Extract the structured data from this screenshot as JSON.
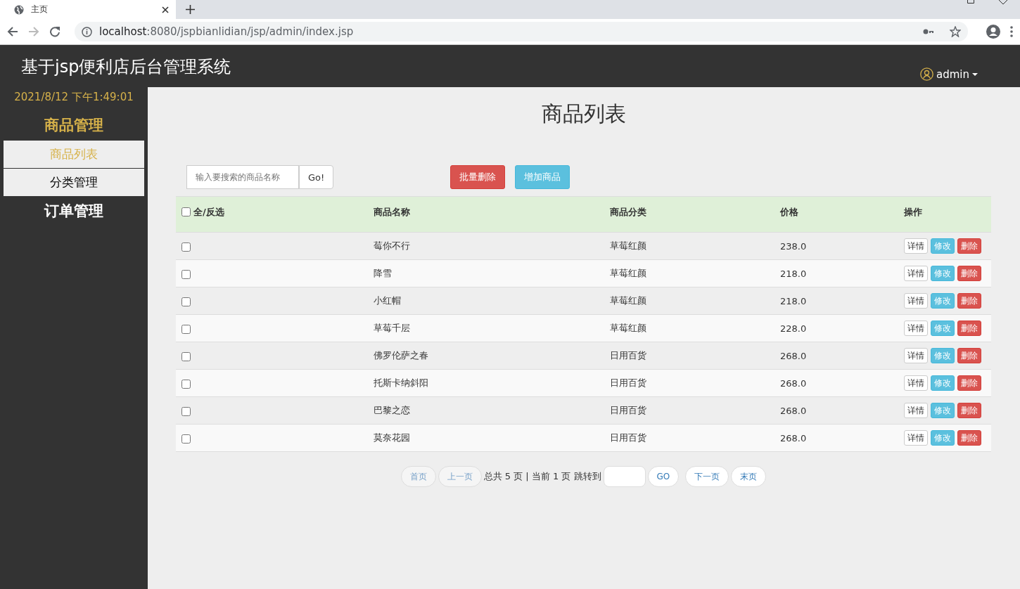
{
  "browser": {
    "tab_title": "主页",
    "url_host": "localhost",
    "url_path": ":8080/jspbianlidian/jsp/admin/index.jsp"
  },
  "header": {
    "title": "基于jsp便利店后台管理系统",
    "user": "admin"
  },
  "sidebar": {
    "datetime": "2021/8/12 下午1:49:01",
    "groups": [
      {
        "label": "商品管理",
        "selected": true,
        "items": [
          {
            "label": "商品列表",
            "selected": true
          },
          {
            "label": "分类管理",
            "selected": false
          }
        ]
      },
      {
        "label": "订单管理",
        "selected": false
      }
    ]
  },
  "page_title": "商品列表",
  "search": {
    "placeholder": "输入要搜索的商品名称",
    "button": "Go!"
  },
  "toolbar_buttons": [
    {
      "label": "批量删除",
      "kind": "danger"
    },
    {
      "label": "增加商品",
      "kind": "info"
    }
  ],
  "table": {
    "select_all": {
      "label": "全/反选",
      "checked": false
    },
    "columns": [
      "商品名称",
      "商品分类",
      "价格",
      "操作"
    ],
    "rows": [
      {
        "checked": false,
        "name": "莓你不行",
        "category": "草莓红颜",
        "price": "238.0",
        "actions": [
          {
            "label": "详情",
            "kind": "default"
          },
          {
            "label": "修改",
            "kind": "info"
          },
          {
            "label": "删除",
            "kind": "danger"
          }
        ]
      },
      {
        "checked": false,
        "name": "降雪",
        "category": "草莓红颜",
        "price": "218.0",
        "actions": [
          {
            "label": "详情",
            "kind": "default"
          },
          {
            "label": "修改",
            "kind": "info"
          },
          {
            "label": "删除",
            "kind": "danger"
          }
        ]
      },
      {
        "checked": false,
        "name": "小红帽",
        "category": "草莓红颜",
        "price": "218.0",
        "actions": [
          {
            "label": "详情",
            "kind": "default"
          },
          {
            "label": "修改",
            "kind": "info"
          },
          {
            "label": "删除",
            "kind": "danger"
          }
        ]
      },
      {
        "checked": false,
        "name": "草莓千层",
        "category": "草莓红颜",
        "price": "228.0",
        "actions": [
          {
            "label": "详情",
            "kind": "default"
          },
          {
            "label": "修改",
            "kind": "info"
          },
          {
            "label": "删除",
            "kind": "danger"
          }
        ]
      },
      {
        "checked": false,
        "name": "佛罗伦萨之春",
        "category": "日用百货",
        "price": "268.0",
        "actions": [
          {
            "label": "详情",
            "kind": "default"
          },
          {
            "label": "修改",
            "kind": "info"
          },
          {
            "label": "删除",
            "kind": "danger"
          }
        ]
      },
      {
        "checked": false,
        "name": "托斯卡纳斜阳",
        "category": "日用百货",
        "price": "268.0",
        "actions": [
          {
            "label": "详情",
            "kind": "default"
          },
          {
            "label": "修改",
            "kind": "info"
          },
          {
            "label": "删除",
            "kind": "danger"
          }
        ]
      },
      {
        "checked": false,
        "name": "巴黎之恋",
        "category": "日用百货",
        "price": "268.0",
        "actions": [
          {
            "label": "详情",
            "kind": "default"
          },
          {
            "label": "修改",
            "kind": "info"
          },
          {
            "label": "删除",
            "kind": "danger"
          }
        ]
      },
      {
        "checked": false,
        "name": "莫奈花园",
        "category": "日用百货",
        "price": "268.0",
        "actions": [
          {
            "label": "详情",
            "kind": "default"
          },
          {
            "label": "修改",
            "kind": "info"
          },
          {
            "label": "删除",
            "kind": "danger"
          }
        ]
      }
    ]
  },
  "pagination": {
    "first": "首页",
    "prev": "上一页",
    "info": "总共 5 页 | 当前 1 页 跳转到",
    "go": "GO",
    "next": "下一页",
    "last": "末页"
  }
}
